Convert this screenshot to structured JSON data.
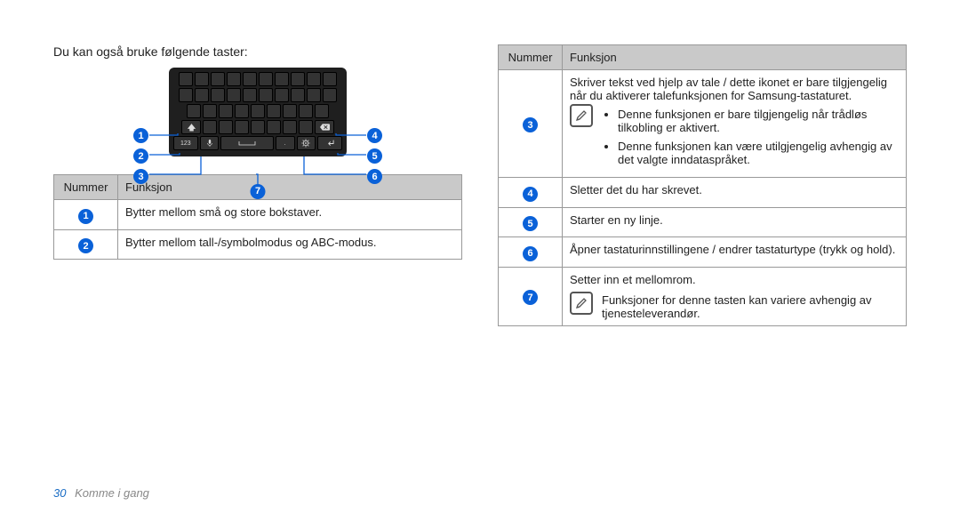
{
  "intro": "Du kan også bruke følgende taster:",
  "headers": {
    "num": "Nummer",
    "fn": "Funksjon"
  },
  "left_table": {
    "rows": [
      {
        "n": "1",
        "text": "Bytter mellom små og store bokstaver."
      },
      {
        "n": "2",
        "text": "Bytter mellom tall-/symbolmodus og ABC-modus."
      }
    ]
  },
  "right_table": {
    "row3": {
      "n": "3",
      "lead": "Skriver tekst ved hjelp av tale / dette ikonet er bare tilgjengelig når du aktiverer talefunksjonen for Samsung-tastaturet.",
      "bullet1": "Denne funksjonen er bare tilgjengelig når trådløs tilkobling er aktivert.",
      "bullet2": "Denne funksjonen kan være utilgjengelig avhengig av det valgte inndataspråket."
    },
    "row4": {
      "n": "4",
      "text": "Sletter det du har skrevet."
    },
    "row5": {
      "n": "5",
      "text": "Starter en ny linje."
    },
    "row6": {
      "n": "6",
      "text": "Åpner tastaturinnstillingene / endrer tastaturtype (trykk og hold)."
    },
    "row7": {
      "n": "7",
      "lead": "Setter inn et mellomrom.",
      "note": "Funksjoner for denne tasten kan variere avhengig av tjenesteleverandør."
    }
  },
  "callouts": {
    "c1": "1",
    "c2": "2",
    "c3": "3",
    "c4": "4",
    "c5": "5",
    "c6": "6",
    "c7": "7"
  },
  "footer": {
    "page": "30",
    "section": "Komme i gang"
  }
}
